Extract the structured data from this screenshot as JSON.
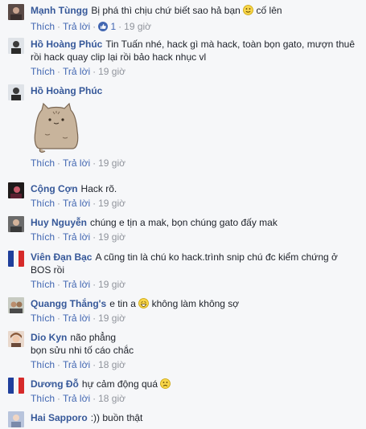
{
  "actions": {
    "like_label": "Thích",
    "reply_label": "Trả lời",
    "separator": "·"
  },
  "comments": [
    {
      "name": "Mạnh Tùngg",
      "text": "Bị phá thì chịu chứ biết sao hả bạn",
      "text_after": "cố lên",
      "time": "19 giờ",
      "like_count": "1",
      "emoji": "smile-emoji"
    },
    {
      "name": "Hồ Hoàng Phúc",
      "text": "Tin Tuấn nhé, hack gì mà hack, toàn bọn gato, mượn thuê rồi hack quay clip lại rồi bảo hack nhục vl",
      "time": "19 giờ"
    },
    {
      "name": "Hồ Hoàng Phúc",
      "text": "",
      "time": "19 giờ",
      "sticker": "pusheen-cat-sticker"
    },
    {
      "name": "Cộng Cợn",
      "text": "Hack rõ.",
      "time": "19 giờ"
    },
    {
      "name": "Huy Nguyễn",
      "text": "chúng e tịn a mak, bọn chúng gato đấy mak",
      "time": "19 giờ"
    },
    {
      "name": "Viên Đạn Bạc",
      "text": "A cũng tin là chú ko hack.trình snip chú đc kiểm chứng ở BOS rồi",
      "time": "19 giờ"
    },
    {
      "name": "Quangg Thắng's",
      "text": "e tin a",
      "text_after": "không làm không sợ",
      "time": "19 giờ",
      "emoji": "grin-emoji"
    },
    {
      "name": "Dio Kyn",
      "text": "não phẳng",
      "text_line2": "bọn sửu nhi tố cáo chắc",
      "time": "18 giờ"
    },
    {
      "name": "Dương Đỗ",
      "text": "hự cảm động quá",
      "time": "18 giờ",
      "emoji": "frown-emoji"
    },
    {
      "name": "Hai Sapporo",
      "text": ":)) buồn thật",
      "time": ""
    }
  ],
  "colors": {
    "name": "#365899",
    "link": "#4267b2",
    "meta": "#90949c",
    "background": "#f6f7f9"
  }
}
